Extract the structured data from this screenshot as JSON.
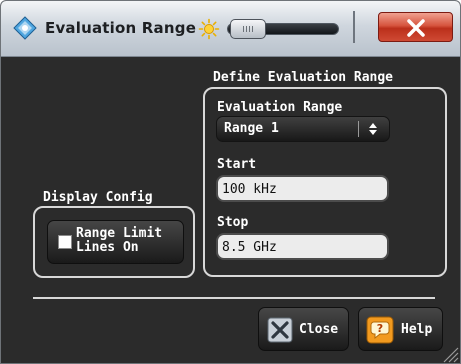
{
  "window": {
    "title": "Evaluation Range",
    "app_icon": "diamond-app-icon",
    "controls": {
      "brightness_icon": "sun-icon",
      "transparency_slider": "transparency-slider",
      "close_icon": "close-x-icon"
    }
  },
  "define_group": {
    "title": "Define Evaluation Range",
    "evaluation_range_label": "Evaluation Range",
    "evaluation_range_value": "Range 1",
    "start_label": "Start",
    "start_value": "100 kHz",
    "stop_label": "Stop",
    "stop_value": "8.5 GHz"
  },
  "display_group": {
    "title": "Display Config",
    "range_limit_checkbox_label": "Range Limit\nLines On",
    "range_limit_checked": false
  },
  "buttons": {
    "close_label": "Close",
    "close_icon": "close-x-icon",
    "help_label": "Help",
    "help_icon": "help-question-icon"
  },
  "colors": {
    "dialog_background": "#2b2b2b",
    "title_close_red": "#d6543e",
    "help_icon_orange": "#f29a1f",
    "text": "#ffffff"
  }
}
